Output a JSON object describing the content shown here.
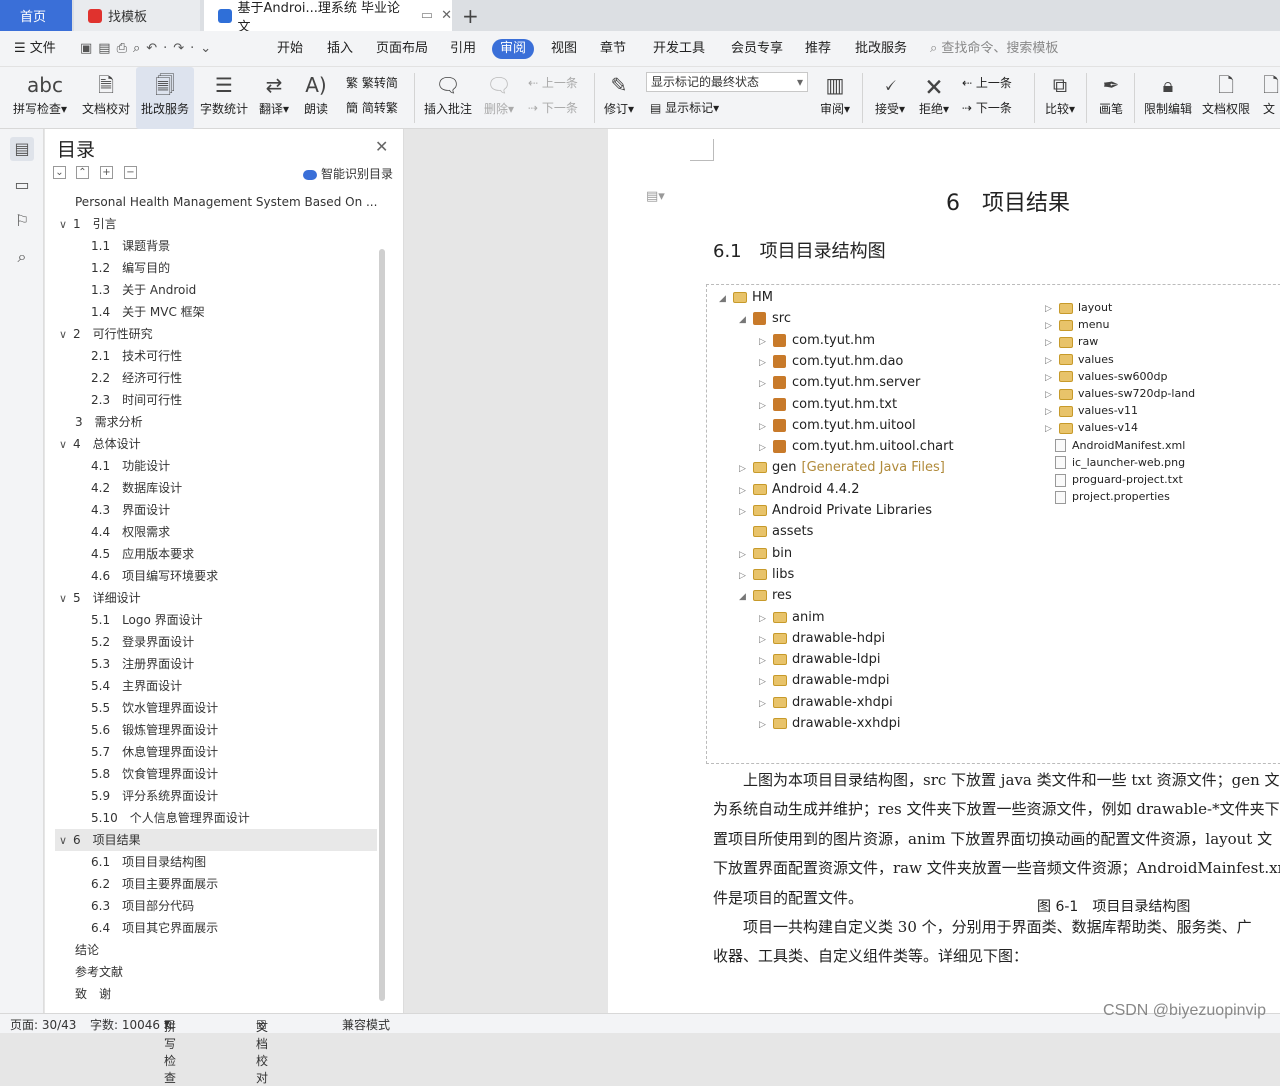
{
  "tabs": [
    {
      "label": "首页"
    },
    {
      "label": "找模板"
    },
    {
      "label": "基于Androi...理系统 毕业论文"
    }
  ],
  "menu": {
    "file": "文件",
    "items": [
      "开始",
      "插入",
      "页面布局",
      "引用",
      "审阅",
      "视图",
      "章节",
      "开发工具",
      "会员专享",
      "推荐",
      "批改服务"
    ],
    "search": "查找命令、搜索模板"
  },
  "ribbon": {
    "spell": "拼写检查",
    "proof": "文档校对",
    "correct": "批改服务",
    "wordcount": "字数统计",
    "translate": "翻译",
    "read": "朗读",
    "trad": "繁转简",
    "simp": "简转繁",
    "insert_comment": "插入批注",
    "delete": "删除",
    "prev": "上一条",
    "next": "下一条",
    "revise": "修订",
    "markup_select": "显示标记的最终状态",
    "show_markup": "显示标记",
    "review": "审阅",
    "accept": "接受",
    "reject": "拒绝",
    "prev2": "上一条",
    "next2": "下一条",
    "compare": "比较",
    "pen": "画笔",
    "restrict": "限制编辑",
    "perm": "文档权限",
    "more": "文"
  },
  "toc": {
    "title": "目录",
    "smart": "智能识别目录",
    "items": [
      {
        "text": "Personal Health Management System Based On ...",
        "level": 0,
        "caret": ""
      },
      {
        "text": "1　引言",
        "level": 0,
        "caret": "∨"
      },
      {
        "text": "1.1　课题背景",
        "level": 1,
        "caret": ""
      },
      {
        "text": "1.2　编写目的",
        "level": 1,
        "caret": ""
      },
      {
        "text": "1.3　关于 Android",
        "level": 1,
        "caret": ""
      },
      {
        "text": "1.4　关于 MVC 框架",
        "level": 1,
        "caret": ""
      },
      {
        "text": "2　可行性研究",
        "level": 0,
        "caret": "∨"
      },
      {
        "text": "2.1　技术可行性",
        "level": 1,
        "caret": ""
      },
      {
        "text": "2.2　经济可行性",
        "level": 1,
        "caret": ""
      },
      {
        "text": "2.3　时间可行性",
        "level": 1,
        "caret": ""
      },
      {
        "text": "3　需求分析",
        "level": 0,
        "caret": ""
      },
      {
        "text": "4　总体设计",
        "level": 0,
        "caret": "∨"
      },
      {
        "text": "4.1　功能设计",
        "level": 1,
        "caret": ""
      },
      {
        "text": "4.2　数据库设计",
        "level": 1,
        "caret": ""
      },
      {
        "text": "4.3　界面设计",
        "level": 1,
        "caret": ""
      },
      {
        "text": "4.4　权限需求",
        "level": 1,
        "caret": ""
      },
      {
        "text": "4.5　应用版本要求",
        "level": 1,
        "caret": ""
      },
      {
        "text": "4.6　项目编写环境要求",
        "level": 1,
        "caret": ""
      },
      {
        "text": "5　详细设计",
        "level": 0,
        "caret": "∨"
      },
      {
        "text": "5.1　Logo 界面设计",
        "level": 1,
        "caret": ""
      },
      {
        "text": "5.2　登录界面设计",
        "level": 1,
        "caret": ""
      },
      {
        "text": "5.3　注册界面设计",
        "level": 1,
        "caret": ""
      },
      {
        "text": "5.4　主界面设计",
        "level": 1,
        "caret": ""
      },
      {
        "text": "5.5　饮水管理界面设计",
        "level": 1,
        "caret": ""
      },
      {
        "text": "5.6　锻炼管理界面设计",
        "level": 1,
        "caret": ""
      },
      {
        "text": "5.7　休息管理界面设计",
        "level": 1,
        "caret": ""
      },
      {
        "text": "5.8　饮食管理界面设计",
        "level": 1,
        "caret": ""
      },
      {
        "text": "5.9　评分系统界面设计",
        "level": 1,
        "caret": ""
      },
      {
        "text": "5.10　个人信息管理界面设计",
        "level": 1,
        "caret": ""
      },
      {
        "text": "6　项目结果",
        "level": 0,
        "caret": "∨",
        "selected": true
      },
      {
        "text": "6.1　项目目录结构图",
        "level": 1,
        "caret": ""
      },
      {
        "text": "6.2　项目主要界面展示",
        "level": 1,
        "caret": ""
      },
      {
        "text": "6.3　项目部分代码",
        "level": 1,
        "caret": ""
      },
      {
        "text": "6.4　项目其它界面展示",
        "level": 1,
        "caret": ""
      },
      {
        "text": "结论",
        "level": 0,
        "caret": ""
      },
      {
        "text": "参考文献",
        "level": 0,
        "caret": ""
      },
      {
        "text": "致　谢",
        "level": 0,
        "caret": ""
      }
    ]
  },
  "doc": {
    "h1": "6　项目结果",
    "h2": "6.1　项目目录结构图",
    "tree_left": [
      {
        "text": "HM",
        "icon": "project",
        "caret": "◢"
      },
      {
        "text": "src",
        "icon": "pkg",
        "caret": "◢"
      },
      {
        "text": "com.tyut.hm",
        "icon": "pkg",
        "caret": "▷"
      },
      {
        "text": "com.tyut.hm.dao",
        "icon": "pkg",
        "caret": "▷"
      },
      {
        "text": "com.tyut.hm.server",
        "icon": "pkg",
        "caret": "▷"
      },
      {
        "text": "com.tyut.hm.txt",
        "icon": "pkg",
        "caret": "▷"
      },
      {
        "text": "com.tyut.hm.uitool",
        "icon": "pkg",
        "caret": "▷"
      },
      {
        "text": "com.tyut.hm.uitool.chart",
        "icon": "pkg",
        "caret": "▷"
      },
      {
        "text": "gen",
        "extra": "[Generated Java Files]",
        "icon": "folder",
        "caret": "▷"
      },
      {
        "text": "Android 4.4.2",
        "icon": "lib",
        "caret": "▷"
      },
      {
        "text": "Android Private Libraries",
        "icon": "lib",
        "caret": "▷"
      },
      {
        "text": "assets",
        "icon": "folder",
        "caret": ""
      },
      {
        "text": "bin",
        "icon": "folder",
        "caret": "▷"
      },
      {
        "text": "libs",
        "icon": "folder",
        "caret": "▷"
      },
      {
        "text": "res",
        "icon": "folder",
        "caret": "◢"
      },
      {
        "text": "anim",
        "icon": "folder",
        "caret": "▷"
      },
      {
        "text": "drawable-hdpi",
        "icon": "folder",
        "caret": "▷"
      },
      {
        "text": "drawable-ldpi",
        "icon": "folder",
        "caret": "▷"
      },
      {
        "text": "drawable-mdpi",
        "icon": "folder",
        "caret": "▷"
      },
      {
        "text": "drawable-xhdpi",
        "icon": "folder",
        "caret": "▷"
      },
      {
        "text": "drawable-xxhdpi",
        "icon": "folder",
        "caret": "▷"
      }
    ],
    "tree_right": [
      {
        "text": "layout",
        "icon": "folder",
        "caret": "▷"
      },
      {
        "text": "menu",
        "icon": "folder",
        "caret": "▷"
      },
      {
        "text": "raw",
        "icon": "folder",
        "caret": "▷"
      },
      {
        "text": "values",
        "icon": "folder",
        "caret": "▷"
      },
      {
        "text": "values-sw600dp",
        "icon": "folder",
        "caret": "▷"
      },
      {
        "text": "values-sw720dp-land",
        "icon": "folder",
        "caret": "▷"
      },
      {
        "text": "values-v11",
        "icon": "folder",
        "caret": "▷"
      },
      {
        "text": "values-v14",
        "icon": "folder",
        "caret": "▷"
      },
      {
        "text": "AndroidManifest.xml",
        "icon": "file",
        "caret": ""
      },
      {
        "text": "ic_launcher-web.png",
        "icon": "file",
        "caret": ""
      },
      {
        "text": "proguard-project.txt",
        "icon": "file",
        "caret": ""
      },
      {
        "text": "project.properties",
        "icon": "file",
        "caret": ""
      }
    ],
    "caption": "图 6-1　项目目录结构图",
    "paragraphs": [
      "　　上图为本项目目录结构图，src 下放置 java 类文件和一些 txt 资源文件；gen 文",
      "为系统自动生成并维护；res 文件夹下放置一些资源文件，例如 drawable-*文件夹下",
      "置项目所使用到的图片资源，anim 下放置界面切换动画的配置文件资源，layout 文",
      "下放置界面配置资源文件，raw 文件夹放置一些音频文件资源；AndroidMainfest.xm",
      "件是项目的配置文件。",
      "　　项目一共构建自定义类 30 个，分别用于界面类、数据库帮助类、服务类、广",
      "收器、工具类、自定义组件类等。详细见下图："
    ]
  },
  "status": {
    "page": "页面: 30/43",
    "words": "字数: 10046",
    "spell": "拼写检查",
    "proof": "文档校对",
    "compat": "兼容模式"
  },
  "watermark": "CSDN @biyezuopinvip"
}
